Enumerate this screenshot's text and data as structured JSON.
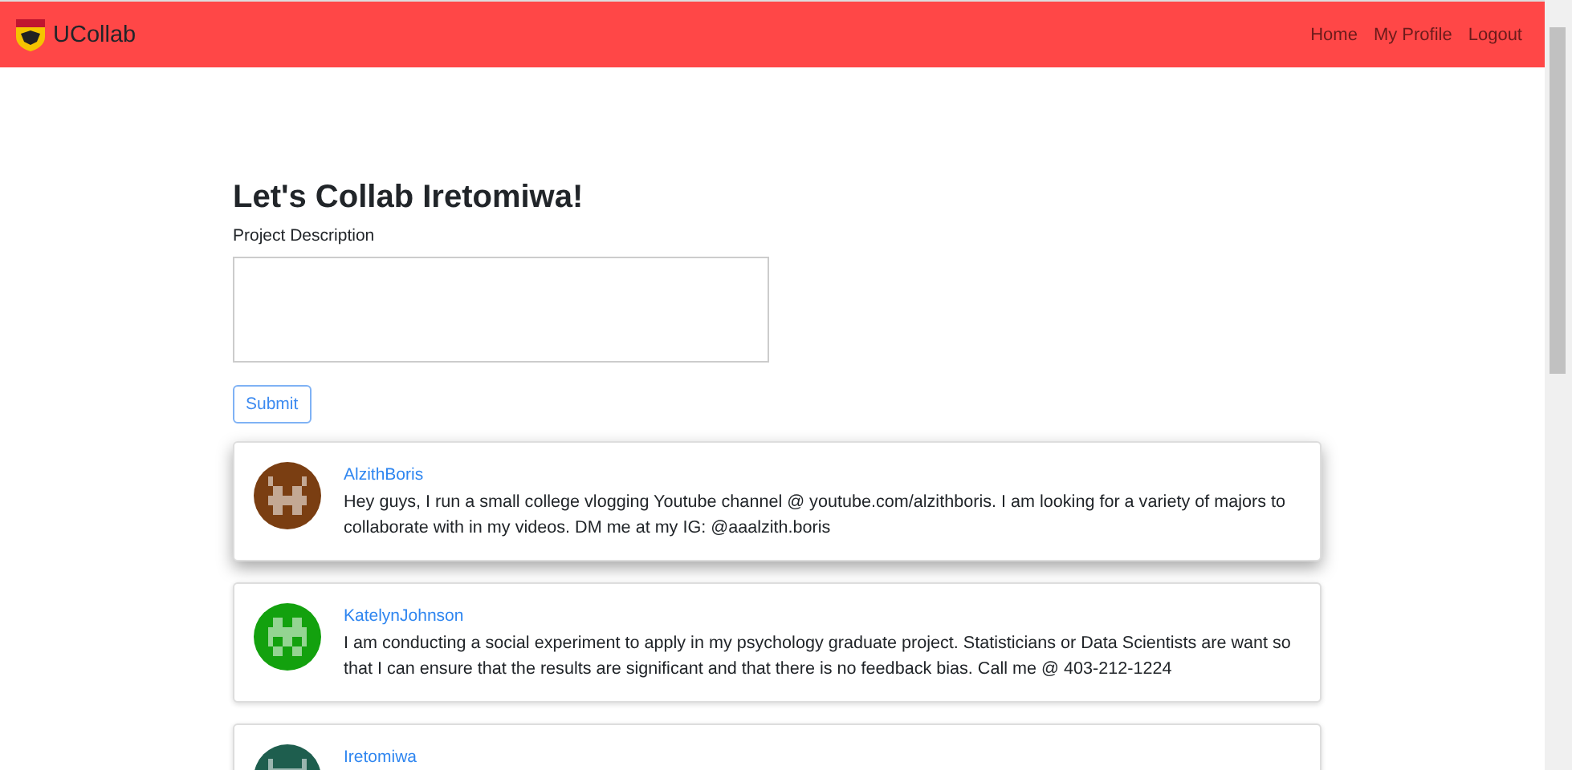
{
  "navbar": {
    "brand": "UCollab",
    "links": [
      "Home",
      "My Profile",
      "Logout"
    ]
  },
  "form": {
    "heading": "Let's Collab Iretomiwa!",
    "label": "Project Description",
    "button": "Submit"
  },
  "posts": [
    {
      "name": "AlzithBoris",
      "text": "Hey guys, I run a small college vlogging Youtube channel @ youtube.com/alzithboris. I am looking for a variety of majors to collaborate with in my videos. DM me at my IG: @aaalzith.boris",
      "raised": true,
      "avatar": {
        "color": "#7a3e12"
      }
    },
    {
      "name": "KatelynJohnson",
      "text": "I am conducting a social experiment to apply in my psychology graduate project. Statisticians or Data Scientists are want so that I can ensure that the results are significant and that there is no feedback bias. Call me @ 403-212-1224",
      "raised": false,
      "avatar": {
        "color": "#13a10e"
      }
    },
    {
      "name": "Iretomiwa",
      "raised": false,
      "avatar": {
        "color": "#1e5e4e"
      }
    }
  ]
}
